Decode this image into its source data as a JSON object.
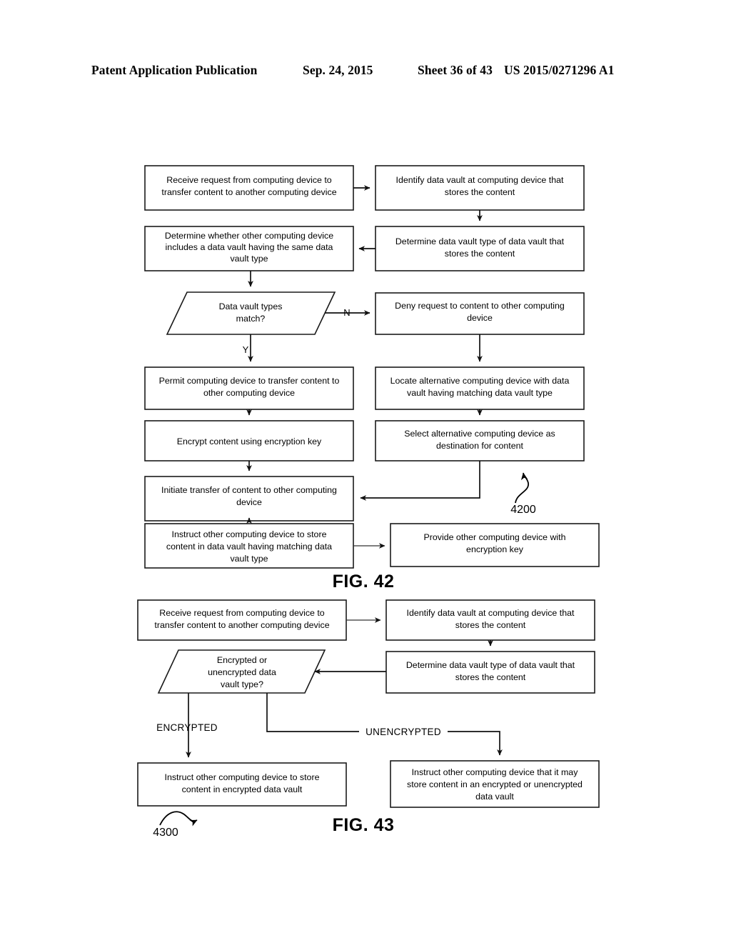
{
  "header": {
    "publication": "Patent Application Publication",
    "date": "Sep. 24, 2015",
    "sheet": "Sheet 36 of 43",
    "number": "US 2015/0271296 A1"
  },
  "figures": [
    {
      "caption": "FIG. 42",
      "reference_numeral": "4200",
      "nodes": [
        {
          "id": "f42-n1",
          "shape": "rect",
          "lines": [
            "Receive request from computing device to",
            "transfer content to another computing device"
          ]
        },
        {
          "id": "f42-n2",
          "shape": "rect",
          "lines": [
            "Identify data vault at computing device that",
            "stores the content"
          ]
        },
        {
          "id": "f42-n3",
          "shape": "rect",
          "lines": [
            "Determine whether other computing device",
            "includes a data vault having the same data",
            "vault type"
          ]
        },
        {
          "id": "f42-n4",
          "shape": "rect",
          "lines": [
            "Determine data vault type of data vault that",
            "stores the content"
          ]
        },
        {
          "id": "f42-n5",
          "shape": "parallelogram",
          "lines": [
            "Data vault types",
            "match?"
          ]
        },
        {
          "id": "f42-n6",
          "shape": "rect",
          "lines": [
            "Deny request to content to other computing",
            "device"
          ]
        },
        {
          "id": "f42-n7",
          "shape": "rect",
          "lines": [
            "Permit computing device to transfer content to",
            "other computing device"
          ]
        },
        {
          "id": "f42-n8",
          "shape": "rect",
          "lines": [
            "Locate alternative computing device with data",
            "vault having matching data vault type"
          ]
        },
        {
          "id": "f42-n9",
          "shape": "rect",
          "lines": [
            "Encrypt content using encryption key"
          ]
        },
        {
          "id": "f42-n10",
          "shape": "rect",
          "lines": [
            "Select alternative computing device as",
            "destination for content"
          ]
        },
        {
          "id": "f42-n11",
          "shape": "rect",
          "lines": [
            "Initiate transfer of content to other computing",
            "device"
          ]
        },
        {
          "id": "f42-n12",
          "shape": "rect",
          "lines": [
            "Instruct other computing device to store",
            "content in data vault having matching data",
            "vault type"
          ]
        },
        {
          "id": "f42-n13",
          "shape": "rect",
          "lines": [
            "Provide other computing device with",
            "encryption key"
          ]
        }
      ],
      "branch_labels": [
        {
          "id": "f42-branch-n",
          "text": "N"
        },
        {
          "id": "f42-branch-y",
          "text": "Y"
        }
      ]
    },
    {
      "caption": "FIG. 43",
      "reference_numeral": "4300",
      "nodes": [
        {
          "id": "f43-n1",
          "shape": "rect",
          "lines": [
            "Receive request from computing device to",
            "transfer content to another computing device"
          ]
        },
        {
          "id": "f43-n2",
          "shape": "rect",
          "lines": [
            "Identify data vault at computing device that",
            "stores the content"
          ]
        },
        {
          "id": "f43-n3",
          "shape": "parallelogram",
          "lines": [
            "Encrypted or",
            "unencrypted data",
            "vault type?"
          ]
        },
        {
          "id": "f43-n4",
          "shape": "rect",
          "lines": [
            "Determine data vault type of data vault that",
            "stores the content"
          ]
        },
        {
          "id": "f43-n5",
          "shape": "rect",
          "lines": [
            "Instruct other computing device to store",
            "content in encrypted data vault"
          ]
        },
        {
          "id": "f43-n6",
          "shape": "rect",
          "lines": [
            "Instruct other computing device that it may",
            "store content in an encrypted or unencrypted",
            "data vault"
          ]
        }
      ],
      "branch_labels": [
        {
          "id": "f43-branch-encrypted",
          "text": "ENCRYPTED"
        },
        {
          "id": "f43-branch-unencrypted",
          "text": "UNENCRYPTED"
        }
      ]
    }
  ]
}
